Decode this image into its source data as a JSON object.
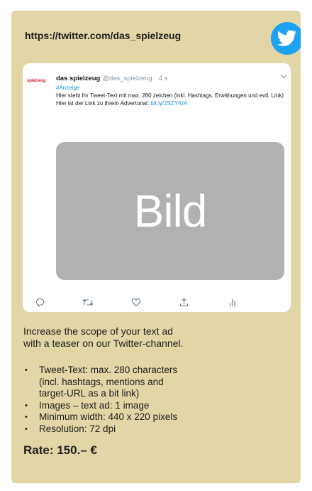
{
  "header": {
    "url": "https://twitter.com/das_spielzeug"
  },
  "tweet": {
    "brand_logo": "spielzeug",
    "author_name": "das spielzeug",
    "author_handle": "@das_spielzeug",
    "time": "4 s",
    "hashtag": "#Anzeige",
    "text_line": "Hier steht Ihr Tweet-Text mit max. 280 zeichen (inkl. Hashtags, Erwähungen und evtl. Link)",
    "link_prefix": "Hier ist der Link zu Ihrem Advertorial: ",
    "link_text": "bit.ly/2SZYfUA",
    "image_label": "Bild",
    "actions": [
      "reply-icon",
      "retweet-icon",
      "like-icon",
      "share-icon",
      "analytics-icon"
    ]
  },
  "intro": {
    "line1": "Increase the scope of your text ad",
    "line2": "with a teaser on our Twitter-channel."
  },
  "specs": [
    "Tweet-Text:  max. 280 characters",
    "(incl. hashtags, mentions and",
    "target-URL as a bit link)",
    "Images – text ad: 1 image",
    "Minimum width: 440 x 220 pixels",
    "Resolution: 72 dpi"
  ],
  "rate": {
    "label": "Rate: 150.– €"
  },
  "colors": {
    "card_background": "#e2d6a6",
    "twitter_blue": "#1da1f2",
    "image_placeholder": "#b1b1b1",
    "brand_red": "#d01f2c"
  }
}
